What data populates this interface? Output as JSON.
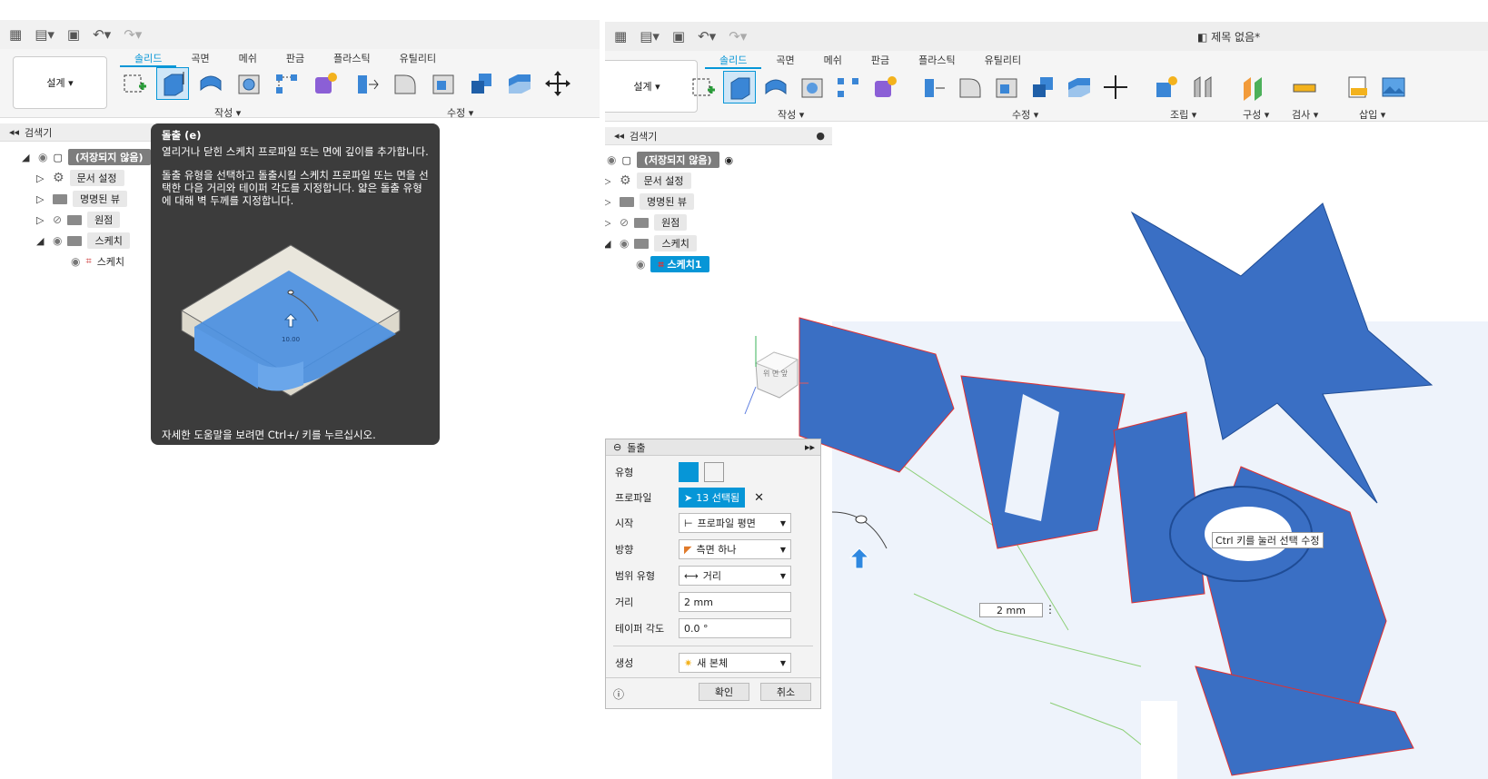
{
  "colors": {
    "accent": "#0696d7",
    "shape_fill": "#3a6fc4",
    "shape_outline": "#e23030",
    "tooltip_bg": "#3c3c3c"
  },
  "left": {
    "tabs": [
      "솔리드",
      "곡면",
      "메쉬",
      "판금",
      "플라스틱",
      "유틸리티"
    ],
    "design_label": "설계 ▾",
    "group_labels": [
      "작성 ▾",
      "수정 ▾"
    ],
    "browser": {
      "title": "검색기",
      "root": "(저장되지 않음)",
      "items": [
        "문서 설정",
        "명명된 뷰",
        "원점",
        "스케치"
      ],
      "sub_item": "스케치"
    },
    "tooltip": {
      "title": "돌출 (e)",
      "para1": "열리거나 닫힌 스케치 프로파일 또는 면에 깊이를 추가합니다.",
      "para2": "돌출 유형을 선택하고 돌출시킬 스케치 프로파일 또는 면을 선택한 다음 거리와 테이퍼 각도를 지정합니다. 얇은 돌출 유형에 대해 벽 두께를 지정합니다.",
      "illustration_value": "10.00",
      "footer": "자세한 도움말을 보려면 Ctrl+/ 키를 누르십시오."
    }
  },
  "right": {
    "doc_title": "제목 없음*",
    "tabs": [
      "솔리드",
      "곡면",
      "메쉬",
      "판금",
      "플라스틱",
      "유틸리티"
    ],
    "design_label": "설계 ▾",
    "group_labels": [
      "작성 ▾",
      "수정 ▾",
      "조립 ▾",
      "구성 ▾",
      "검사 ▾",
      "삽입 ▾"
    ],
    "browser": {
      "title": "검색기",
      "root": "(저장되지 않음)",
      "items": [
        "문서 설정",
        "명명된 뷰",
        "원점",
        "스케치"
      ],
      "sub_item": "스케치1"
    },
    "canvas": {
      "distance_input": "2 mm",
      "hint": "Ctrl 키를 눌러 선택 수정"
    },
    "viewcube": {
      "face": "위 면 앞"
    },
    "dialog": {
      "title": "돌출",
      "rows": [
        {
          "label": "유형",
          "value": ""
        },
        {
          "label": "프로파일",
          "value": "13 선택됨"
        },
        {
          "label": "시작",
          "value": "프로파일 평면"
        },
        {
          "label": "방향",
          "value": "측면 하나"
        },
        {
          "label": "범위 유형",
          "value": "거리"
        },
        {
          "label": "거리",
          "value": "2 mm"
        },
        {
          "label": "테이퍼 각도",
          "value": "0.0 °"
        },
        {
          "label": "생성",
          "value": "새 본체"
        }
      ],
      "ok": "확인",
      "cancel": "취소"
    }
  }
}
